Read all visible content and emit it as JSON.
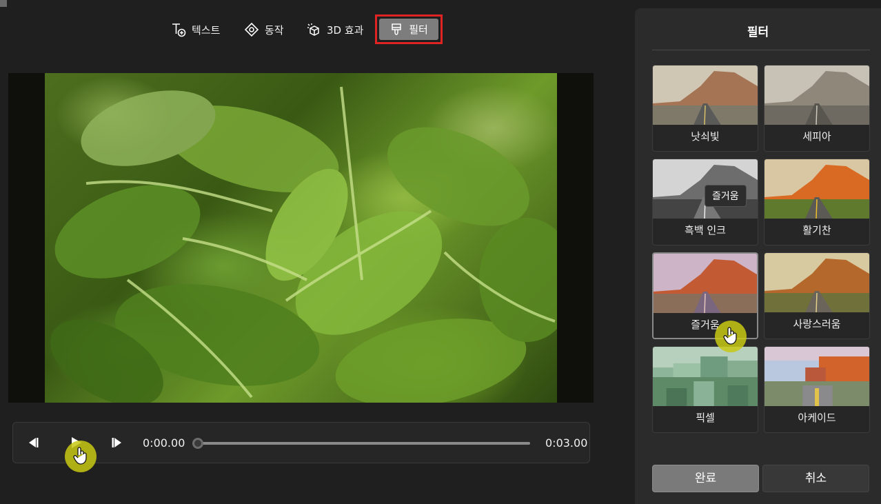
{
  "toolbar": {
    "items": [
      {
        "label": "텍스트",
        "icon": "text-add-icon"
      },
      {
        "label": "동작",
        "icon": "motion-icon"
      },
      {
        "label": "3D 효과",
        "icon": "3d-effects-icon"
      },
      {
        "label": "필터",
        "icon": "filter-brush-icon",
        "highlighted": true
      }
    ],
    "highlight_color": "#e02424"
  },
  "preview": {
    "subject": "spinach leaves photo"
  },
  "playback": {
    "current_time": "0:00.00",
    "total_time": "0:03.00",
    "progress": 0
  },
  "panel": {
    "title": "필터",
    "filters": [
      {
        "label": "낫쇠빛",
        "style": "aged"
      },
      {
        "label": "세피아",
        "style": "sepia"
      },
      {
        "label": "흑백 인크",
        "style": "bw"
      },
      {
        "label": "활기찬",
        "style": "vivid"
      },
      {
        "label": "즐거움",
        "style": "joy",
        "selected": true
      },
      {
        "label": "사랑스러움",
        "style": "lovely"
      },
      {
        "label": "픽셀",
        "style": "pixel"
      },
      {
        "label": "아케이드",
        "style": "arcade"
      }
    ],
    "tooltip": "즐거움",
    "done_label": "완료",
    "cancel_label": "취소"
  },
  "colors": {
    "background": "#1f1f1f",
    "panel": "#2b2b2b",
    "cursor_highlight": "#c8c814"
  }
}
